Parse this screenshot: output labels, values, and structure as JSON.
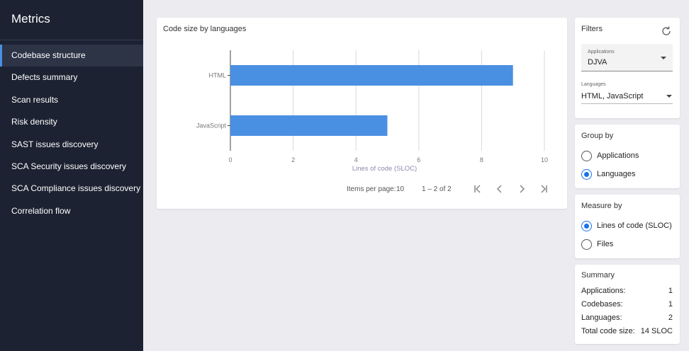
{
  "sidebar": {
    "title": "Metrics",
    "items": [
      {
        "label": "Codebase structure",
        "active": true
      },
      {
        "label": "Defects summary"
      },
      {
        "label": "Scan results"
      },
      {
        "label": "Risk density"
      },
      {
        "label": "SAST issues discovery"
      },
      {
        "label": "SCA Security issues discovery"
      },
      {
        "label": "SCA Compliance issues discovery"
      },
      {
        "label": "Correlation flow"
      }
    ]
  },
  "chart_card": {
    "title": "Code size by languages",
    "pager": {
      "items_per_page_label": "Items per page:",
      "items_per_page_value": "10",
      "range": "1 – 2 of 2"
    }
  },
  "chart_data": {
    "type": "bar",
    "orientation": "horizontal",
    "categories": [
      "HTML",
      "JavaScript"
    ],
    "values": [
      9,
      5
    ],
    "xlabel": "Lines of code (SLOC)",
    "ylabel": "",
    "xlim": [
      0,
      10
    ],
    "xticks": [
      "0",
      "2",
      "4",
      "6",
      "8",
      "10"
    ],
    "grid": true,
    "bar_color": "#4a90e2"
  },
  "filters": {
    "title": "Filters",
    "applications": {
      "label": "Applications",
      "value": "DJVA"
    },
    "languages": {
      "label": "Languages",
      "value": "HTML, JavaScript"
    }
  },
  "group_by": {
    "title": "Group by",
    "options": [
      {
        "label": "Applications",
        "checked": false
      },
      {
        "label": "Languages",
        "checked": true
      }
    ]
  },
  "measure_by": {
    "title": "Measure by",
    "options": [
      {
        "label": "Lines of code (SLOC)",
        "checked": true
      },
      {
        "label": "Files",
        "checked": false
      }
    ]
  },
  "summary": {
    "title": "Summary",
    "rows": [
      {
        "key": "Applications:",
        "value": "1"
      },
      {
        "key": "Codebases:",
        "value": "1"
      },
      {
        "key": "Languages:",
        "value": "2"
      },
      {
        "key": "Total code size:",
        "value": "14 SLOC"
      }
    ]
  },
  "colors": {
    "accent": "#1a73e8",
    "sidebar_bg": "#1c2231",
    "page_bg": "#ecebf0"
  }
}
